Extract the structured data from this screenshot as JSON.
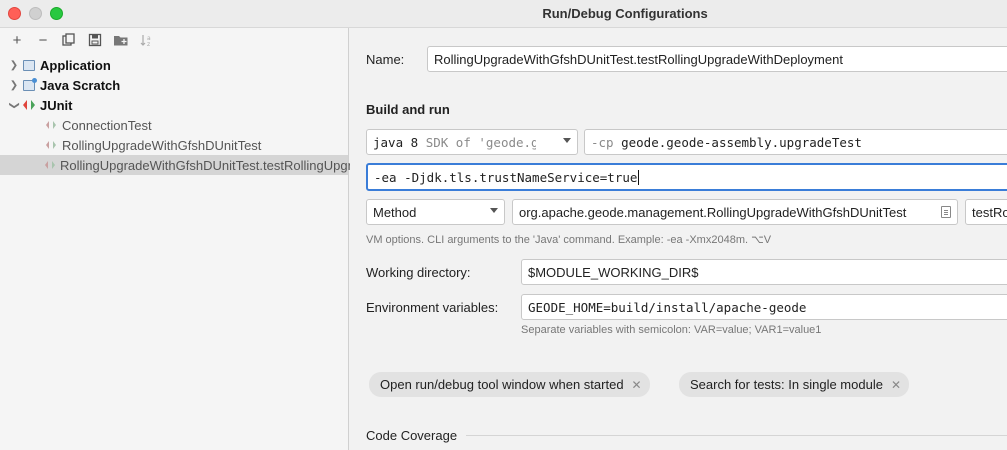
{
  "window": {
    "title": "Run/Debug Configurations"
  },
  "toolbar": {
    "add": "+",
    "remove": "−",
    "copy": "⧉",
    "save": "▣",
    "folder": "▤",
    "sort": "↓a"
  },
  "tree": {
    "application": "Application",
    "java_scratch": "Java Scratch",
    "junit": "JUnit",
    "connection_test": "ConnectionTest",
    "rolling_class": "RollingUpgradeWithGfshDUnitTest",
    "rolling_method": "RollingUpgradeWithGfshDUnitTest.testRollingUpgradeWithDeployment"
  },
  "form": {
    "name_label": "Name:",
    "name_value": "RollingUpgradeWithGfshDUnitTest.testRollingUpgradeWithDeployment",
    "build_and_run": "Build and run",
    "jdk_value": "java 8",
    "jdk_hint": "SDK of 'geode.geode-assembly.upgradeTest' module",
    "cp_flag": "-cp",
    "cp_value": "geode.geode-assembly.upgradeTest",
    "vm_options": "-ea -Djdk.tls.trustNameService=true",
    "test_kind": "Method",
    "class_value": "org.apache.geode.management.RollingUpgradeWithGfshDUnitTest",
    "method_value": "testRollingUpgradeWithDeployment",
    "vm_hint": "VM options. CLI arguments to the 'Java' command. Example: -ea -Xmx2048m. ⌥V",
    "working_dir_label": "Working directory:",
    "working_dir_value": "$MODULE_WORKING_DIR$",
    "env_label": "Environment variables:",
    "env_value": "GEODE_HOME=build/install/apache-geode",
    "env_hint": "Separate variables with semicolon: VAR=value; VAR1=value1",
    "chip_open_tool_window": "Open run/debug tool window when started",
    "chip_search_tests": "Search for tests: In single module",
    "code_coverage": "Code Coverage"
  },
  "colors": {
    "accent": "#3a7dd8",
    "close": "#ff5f57",
    "max": "#28c840"
  }
}
